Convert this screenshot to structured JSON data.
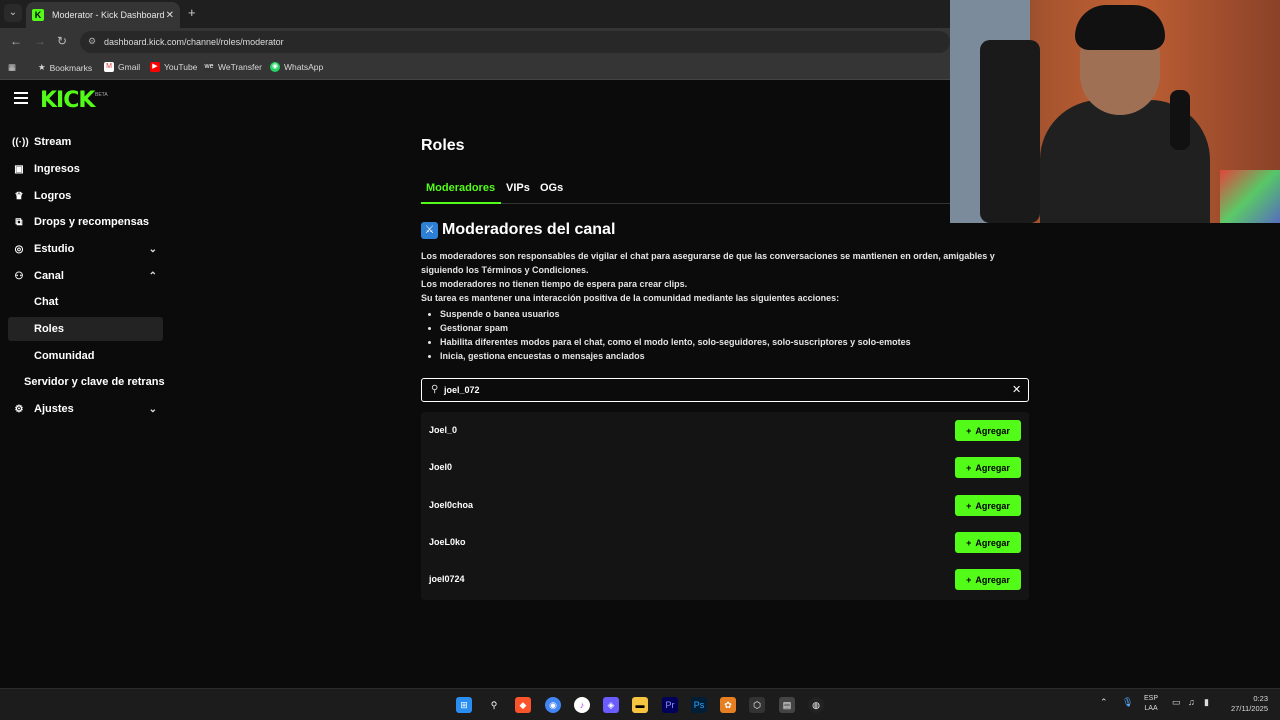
{
  "browser": {
    "tab_title": "Moderator - Kick Dashboard",
    "tab_favicon": "K",
    "url": "dashboard.kick.com/channel/roles/moderator",
    "bookmarks": [
      "Bookmarks",
      "Gmail",
      "YouTube",
      "WeTransfer",
      "WhatsApp"
    ]
  },
  "logo": {
    "text": "KICK",
    "badge": "BETA"
  },
  "sidebar": {
    "items": [
      {
        "label": "Stream",
        "icon": "broadcast-icon"
      },
      {
        "label": "Ingresos",
        "icon": "money-icon"
      },
      {
        "label": "Logros",
        "icon": "trophy-icon"
      },
      {
        "label": "Drops y recompensas",
        "icon": "gift-icon"
      },
      {
        "label": "Estudio",
        "icon": "studio-icon"
      },
      {
        "label": "Canal",
        "icon": "channel-icon"
      },
      {
        "label": "Ajustes",
        "icon": "gear-icon"
      }
    ],
    "canal_sub": [
      "Chat",
      "Roles",
      "Comunidad",
      "Servidor y clave de retrans"
    ],
    "active_sub": "Roles"
  },
  "main": {
    "title": "Roles",
    "tabs": [
      "Moderadores",
      "VIPs",
      "OGs"
    ],
    "active_tab": "Moderadores",
    "section_title": "Moderadores del canal",
    "desc_lines": [
      "Los moderadores son responsables de vigilar el chat para asegurarse de que las conversaciones se mantienen en orden, amigables y",
      "siguiendo los Términos y Condiciones.",
      "Los moderadores no tienen tiempo de espera para crear clips.",
      "Su tarea es mantener una interacción positiva de la comunidad mediante las siguientes acciones:"
    ],
    "bullets": [
      "Suspende o banea usuarios",
      "Gestionar spam",
      "Habilita diferentes modos para el chat, como el modo lento, solo-seguidores, solo-suscriptores y solo-emotes",
      "Inicia, gestiona encuestas o mensajes anclados"
    ],
    "search_value": "joel_072",
    "results": [
      "Joel_0",
      "Joel0",
      "Joel0choa",
      "JoeL0ko",
      "joel0724"
    ],
    "add_label": "Agregar"
  },
  "taskbar": {
    "lang_top": "ESP",
    "lang_bottom": "LAA",
    "time": "0:23",
    "date": "27/11/2025"
  },
  "colors": {
    "accent": "#53fc18",
    "bg": "#0b0b0b"
  }
}
